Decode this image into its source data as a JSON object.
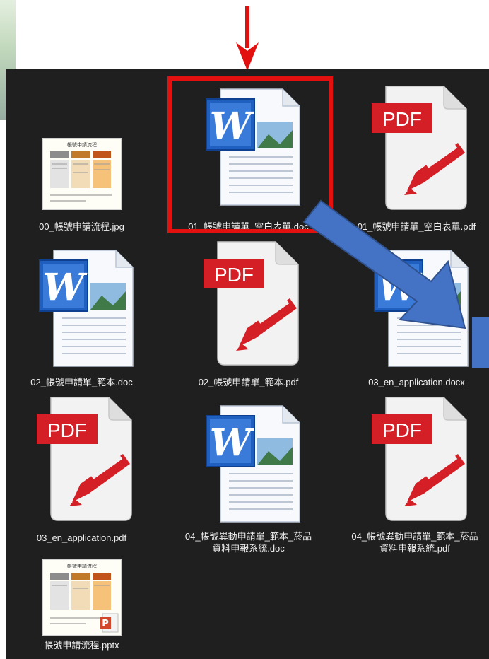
{
  "colors": {
    "explorer_background": "#1f1f1f",
    "label_text": "#f0f0f0",
    "selection_border": "#e31010",
    "annotation_arrow_red": "#e31010",
    "annotation_arrow_blue": "#4472c4",
    "word_blue": "#1f5fbf",
    "pdf_red": "#d41f26"
  },
  "files": [
    {
      "label": "00_帳號申請流程.jpg",
      "icon": "image-thumbnail-icon",
      "type": "jpg"
    },
    {
      "label": "01_帳號申請單_空白表單.doc",
      "icon": "word-document-icon",
      "type": "doc",
      "selected": true
    },
    {
      "label": "01_帳號申請單_空白表單.pdf",
      "icon": "pdf-document-icon",
      "type": "pdf"
    },
    {
      "label": "02_帳號申請單_範本.doc",
      "icon": "word-document-icon",
      "type": "doc"
    },
    {
      "label": "02_帳號申請單_範本.pdf",
      "icon": "pdf-document-icon",
      "type": "pdf"
    },
    {
      "label": "03_en_application.docx",
      "icon": "word-document-icon",
      "type": "docx"
    },
    {
      "label": "03_en_application.pdf",
      "icon": "pdf-document-icon",
      "type": "pdf"
    },
    {
      "label": "04_帳號異動申請單_範本_菸品資料申報系統.doc",
      "icon": "word-document-icon",
      "type": "doc"
    },
    {
      "label": "04_帳號異動申請單_範本_菸品資料申報系統.pdf",
      "icon": "pdf-document-icon",
      "type": "pdf"
    },
    {
      "label": "帳號申請流程.pptx",
      "icon": "powerpoint-thumbnail-icon",
      "type": "pptx"
    }
  ],
  "thumbnail_text": {
    "pdf_badge": "PDF",
    "word_letter": "W",
    "flow_title": "帳號申請流程",
    "ppt_letter": "P"
  }
}
